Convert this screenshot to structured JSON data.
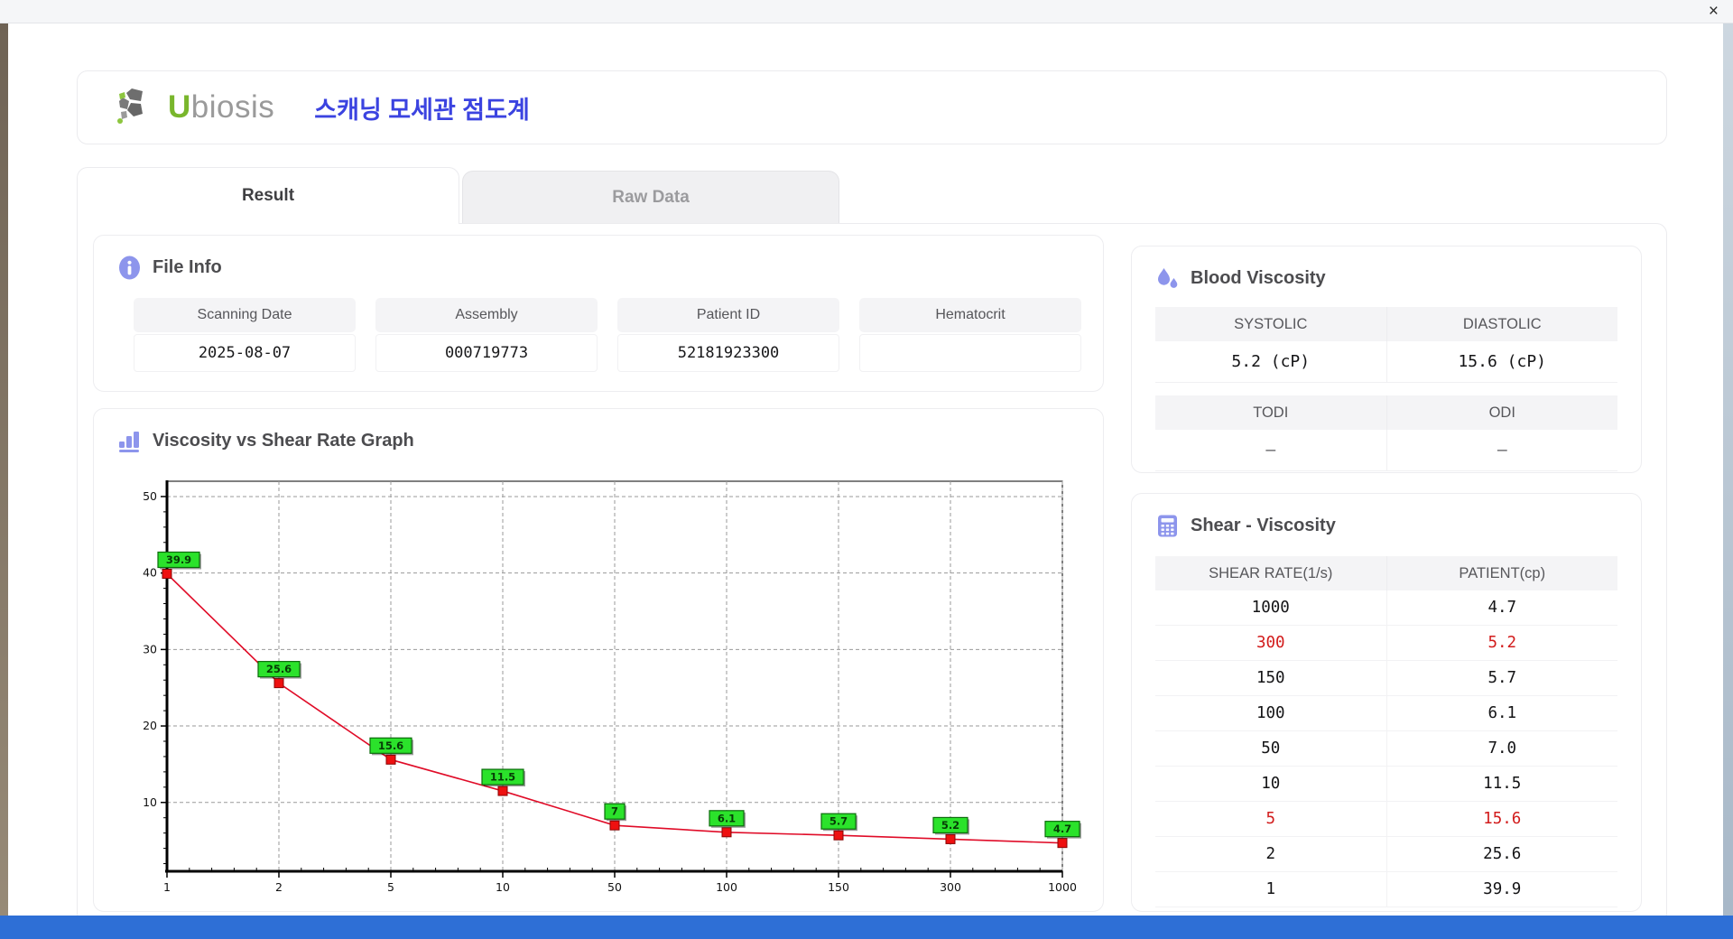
{
  "window": {
    "close_label": "×"
  },
  "header": {
    "logo_u": "U",
    "logo_rest": "biosis",
    "title": "스캐닝 모세관 점도계"
  },
  "tabs": [
    {
      "label": "Result",
      "active": true
    },
    {
      "label": "Raw Data",
      "active": false
    }
  ],
  "file_info": {
    "title": "File Info",
    "fields": [
      {
        "label": "Scanning Date",
        "value": "2025-08-07"
      },
      {
        "label": "Assembly",
        "value": "000719773"
      },
      {
        "label": "Patient ID",
        "value": "52181923300"
      },
      {
        "label": "Hematocrit",
        "value": ""
      }
    ]
  },
  "blood_viscosity": {
    "title": "Blood Viscosity",
    "bands": [
      {
        "headers": [
          "SYSTOLIC",
          "DIASTOLIC"
        ],
        "values": [
          "5.2 (cP)",
          "15.6 (cP)"
        ]
      },
      {
        "headers": [
          "TODI",
          "ODI"
        ],
        "values": [
          "–",
          "–"
        ]
      }
    ]
  },
  "graph": {
    "title": "Viscosity vs Shear Rate Graph"
  },
  "chart_data": {
    "type": "line",
    "title": "Viscosity vs Shear Rate Graph",
    "xlabel": "",
    "ylabel": "",
    "x_axis_type": "categorical-even-spacing",
    "x": [
      1,
      2,
      5,
      10,
      50,
      100,
      150,
      300,
      1000
    ],
    "x_tick_labels": [
      "1",
      "2",
      "5",
      "10",
      "50",
      "100",
      "150",
      "300",
      "1000"
    ],
    "values": [
      39.9,
      25.6,
      15.6,
      11.5,
      7,
      6.1,
      5.7,
      5.2,
      4.7
    ],
    "point_labels": [
      "39.9",
      "25.6",
      "15.6",
      "11.5",
      "7",
      "6.1",
      "5.7",
      "5.2",
      "4.7"
    ],
    "y_ticks": [
      10,
      20,
      30,
      40,
      50
    ],
    "ylim": [
      1,
      52
    ],
    "grid": "dashed",
    "legend": "none",
    "line_color": "#e00c28",
    "marker_color": "#ee1010",
    "marker_border": "#8a0404",
    "label_bg": "#2be22b",
    "label_border": "#0c6c0c"
  },
  "shear_viscosity": {
    "title": "Shear - Viscosity",
    "columns": [
      "SHEAR RATE(1/s)",
      "PATIENT(cp)"
    ],
    "rows": [
      {
        "shear": "1000",
        "patient": "4.7",
        "highlight": false
      },
      {
        "shear": "300",
        "patient": "5.2",
        "highlight": true
      },
      {
        "shear": "150",
        "patient": "5.7",
        "highlight": false
      },
      {
        "shear": "100",
        "patient": "6.1",
        "highlight": false
      },
      {
        "shear": "50",
        "patient": "7.0",
        "highlight": false
      },
      {
        "shear": "10",
        "patient": "11.5",
        "highlight": false
      },
      {
        "shear": "5",
        "patient": "15.6",
        "highlight": true
      },
      {
        "shear": "2",
        "patient": "25.6",
        "highlight": false
      },
      {
        "shear": "1",
        "patient": "39.9",
        "highlight": false
      }
    ],
    "highlight_color": "#d21c1c"
  },
  "colors": {
    "accent_icon": "#8d95ec",
    "title_blue": "#3b43e0",
    "logo_green": "#79b62c",
    "bottom_bar": "#2e6fd6",
    "red_text": "#d21c1c"
  }
}
